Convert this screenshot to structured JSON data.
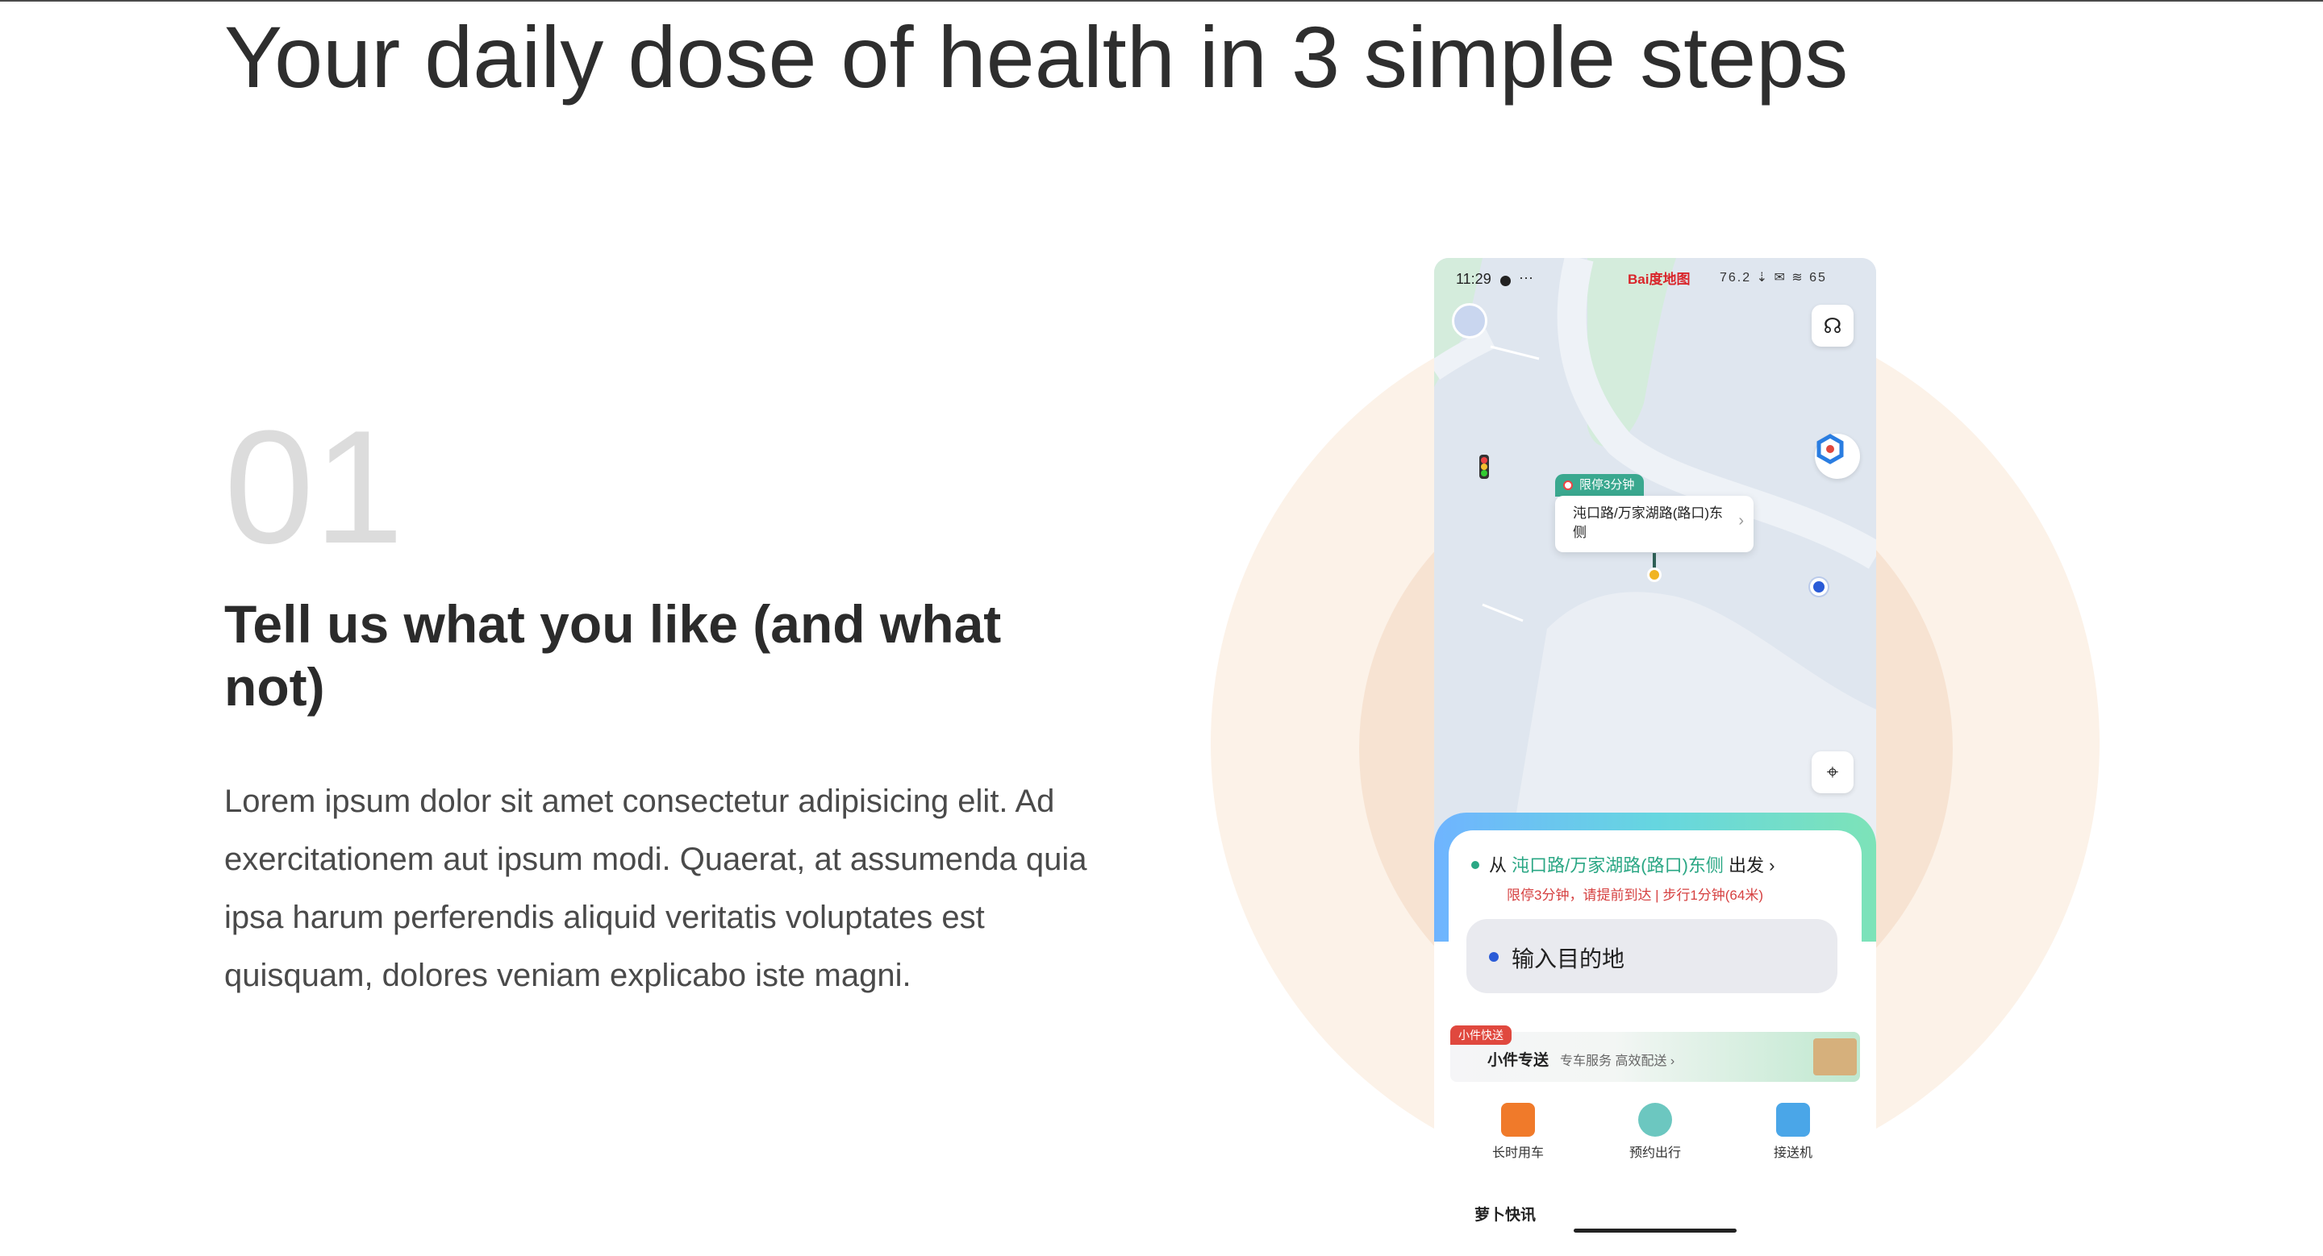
{
  "page": {
    "headline": "Your daily dose of health in 3 simple steps"
  },
  "step": {
    "number": "01",
    "title": "Tell us what you like (and what not)",
    "body": "Lorem ipsum dolor sit amet consectetur adipisicing elit. Ad exercitationem aut ipsum modi. Quaerat, at assumenda quia ipsa harum perferendis aliquid veritatis voluptates est quisquam, dolores veniam explicabo iste magni."
  },
  "phone": {
    "status": {
      "time": "11:29",
      "more": "···",
      "brand": "Bai度地图",
      "icons": "76.2 ⇣ ✉ ≋ 65"
    },
    "map": {
      "pin_tag": "限停3分钟",
      "pin_text": "沌口路/万家湖路(路口)东侧",
      "pin_chevron": "›"
    },
    "panel": {
      "from_prefix": "从",
      "from_place": "沌口路/万家湖路(路口)东侧",
      "from_suffix": "出发 ›",
      "from_note": "限停3分钟，请提前到达 | 步行1分钟(64米)",
      "destination_placeholder": "输入目的地"
    },
    "promo": {
      "tag": "小件快送",
      "title": "小件专送",
      "subtitle": "专车服务 高效配送 ›"
    },
    "services": [
      {
        "label": "长时用车",
        "icon": "car-rental-icon",
        "color": "#f07a2a"
      },
      {
        "label": "预约出行",
        "icon": "clock-icon",
        "color": "#6cc7c0"
      },
      {
        "label": "接送机",
        "icon": "plane-icon",
        "color": "#4aa6e8"
      }
    ],
    "news_title": "萝卜快讯"
  },
  "colors": {
    "accent_green": "#2aa784",
    "accent_blue": "#2a5bd7",
    "warning_red": "#d64040",
    "circle_outer": "#fcf2e8",
    "circle_inner": "#f7e3d2"
  }
}
